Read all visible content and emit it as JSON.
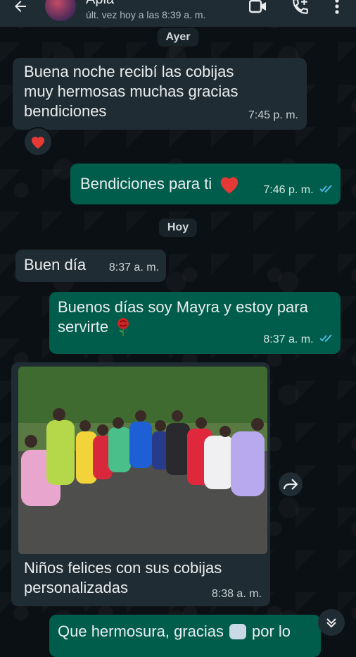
{
  "header": {
    "contact_name": "Apia",
    "last_seen": "últ. vez hoy a las 8:39 a. m."
  },
  "colors": {
    "header_bg": "#1f2c34",
    "incoming_bubble": "#202c33",
    "outgoing_bubble": "#005c4b",
    "read_ticks": "#53bdeb",
    "heart": "#e53935"
  },
  "dates": {
    "yesterday": "Ayer",
    "today": "Hoy"
  },
  "messages": [
    {
      "text_line1": "Buena noche recibí las cobijas",
      "text_line2": "muy hermosas muchas gracias",
      "text_line3": "bendiciones",
      "time": "7:45 p. m.",
      "reaction": "heart"
    },
    {
      "text": "Bendiciones para ti",
      "time": "7:46 p. m."
    },
    {
      "text": "Buen día",
      "time": "8:37 a. m."
    },
    {
      "text_line1": "Buenos días soy Mayra y estoy para",
      "text_line2": "servirte",
      "time": "8:37 a. m."
    },
    {
      "caption_line1": "Niños felices con sus cobijas",
      "caption_line2": "personalizadas",
      "time": "8:38 a. m."
    },
    {
      "text": "Que hermosura, gracias",
      "text_end": "por lo"
    }
  ],
  "icons": [
    "back-arrow-icon",
    "avatar",
    "video-call-icon",
    "add-call-icon",
    "more-options-icon",
    "forward-icon",
    "scroll-down-icon"
  ]
}
